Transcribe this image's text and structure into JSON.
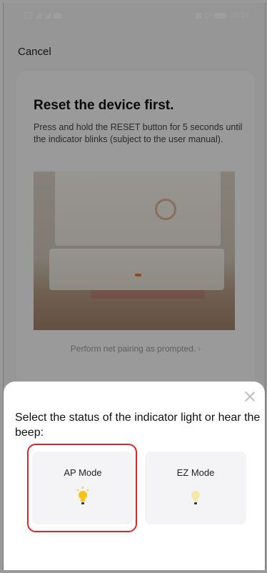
{
  "status_bar": {
    "time": "10:24"
  },
  "header": {
    "cancel_label": "Cancel"
  },
  "card": {
    "title": "Reset the device first.",
    "description": "Press and hold the RESET button for 5 seconds until the indicator blinks (subject to the user manual).",
    "prompt_link": "Perform net pairing as prompted."
  },
  "sheet": {
    "prompt": "Select the status of the indicator light or hear the beep:",
    "modes": [
      {
        "label": "AP Mode",
        "icon": "bulb-blinking-icon",
        "selected": true
      },
      {
        "label": "EZ Mode",
        "icon": "bulb-slow-icon",
        "selected": false
      }
    ]
  },
  "colors": {
    "highlight": "#d9262d",
    "bulb_ap": "#f6c21c",
    "bulb_ez": "#f6e6a8"
  }
}
